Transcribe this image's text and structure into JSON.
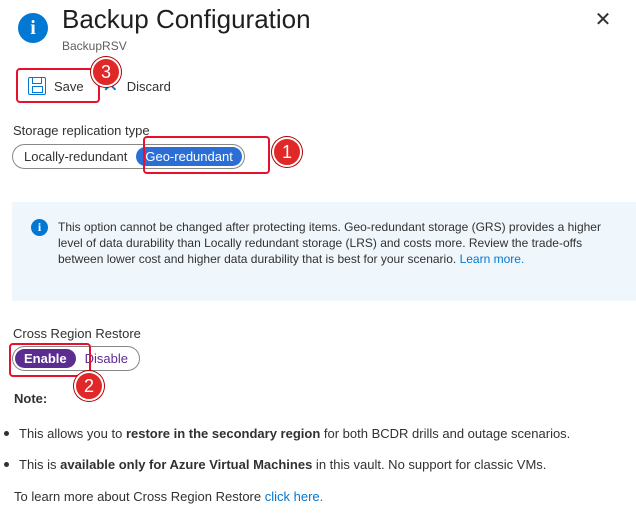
{
  "header": {
    "title": "Backup Configuration",
    "subtitle": "BackupRSV",
    "info_icon": "i",
    "close_icon": "✕"
  },
  "toolbar": {
    "save_label": "Save",
    "discard_label": "Discard",
    "save_icon": "save-icon",
    "discard_icon": "✕"
  },
  "replication": {
    "label": "Storage replication type",
    "options": [
      "Locally-redundant",
      "Geo-redundant"
    ],
    "selected": "Geo-redundant"
  },
  "info": {
    "icon": "i",
    "text": "This option cannot be changed after protecting items.  Geo-redundant storage (GRS) provides a higher level of data durability than Locally redundant storage (LRS) and costs more. Review the trade-offs between lower cost and higher data durability that is best for your scenario.",
    "link": "Learn more."
  },
  "cross_region": {
    "label": "Cross Region Restore",
    "options": [
      "Enable",
      "Disable"
    ],
    "selected": "Enable"
  },
  "note": {
    "title": "Note:",
    "bullet1": {
      "before": "This allows you to ",
      "bold": "restore in the secondary region",
      "after": " for both BCDR drills and outage scenarios."
    },
    "bullet2": {
      "before": "This is ",
      "bold": "available only for Azure Virtual Machines",
      "after": " in this vault. No support for classic VMs."
    },
    "learn_text": "To learn more about Cross Region Restore ",
    "learn_link": "click here."
  },
  "callouts": [
    "1",
    "2",
    "3"
  ],
  "colors": {
    "accent": "#0078d4",
    "geo_selected": "#2b6fd6",
    "enable_selected": "#5c2d91",
    "callout": "#e02828",
    "info_bg": "#eff6fc"
  }
}
